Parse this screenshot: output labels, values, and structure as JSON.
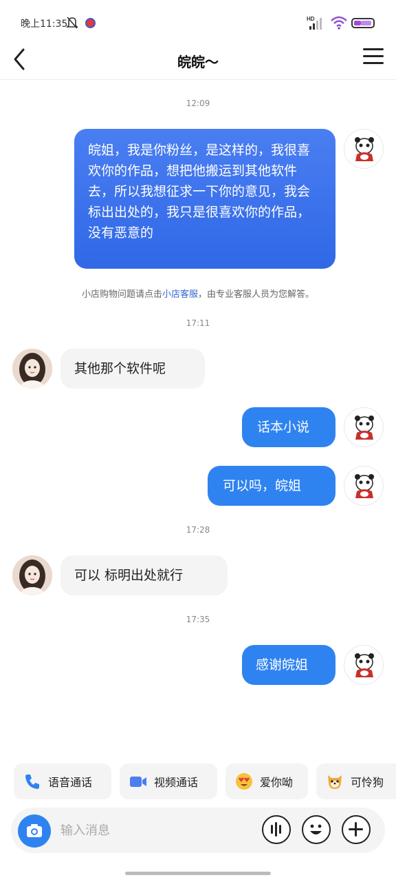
{
  "status_bar": {
    "time": "晚上11:35"
  },
  "header": {
    "title": "皖皖～"
  },
  "chat": {
    "timestamps": [
      "12:09",
      "17:11",
      "17:28",
      "17:35"
    ],
    "notice": {
      "prefix": "小店购物问题请点击",
      "link": "小店客服",
      "suffix": "，由专业客服人员为您解答。"
    },
    "messages": [
      {
        "from": "me",
        "text": "皖姐，我是你粉丝，是这样的，我很喜欢你的作品，想把他搬运到其他软件去，所以我想征求一下你的意见，我会标出出处的，我只是很喜欢你的作品，没有恶意的"
      },
      {
        "from": "other",
        "text": "其他那个软件呢"
      },
      {
        "from": "me",
        "text": "话本小说"
      },
      {
        "from": "me",
        "text": "可以吗，皖姐"
      },
      {
        "from": "other",
        "text": "可以 标明出处就行"
      },
      {
        "from": "me",
        "text": "感谢皖姐"
      }
    ]
  },
  "quick_actions": [
    {
      "label": "语音通话",
      "icon": "phone-icon"
    },
    {
      "label": "视频通话",
      "icon": "video-icon"
    },
    {
      "label": "爱你呦",
      "icon": "heart-eyes-emoji"
    },
    {
      "label": "可怜狗",
      "icon": "puppy-emoji"
    }
  ],
  "input": {
    "placeholder": "输入消息"
  },
  "colors": {
    "accent": "#2f83f1",
    "bubble_other": "#f4f4f4"
  }
}
